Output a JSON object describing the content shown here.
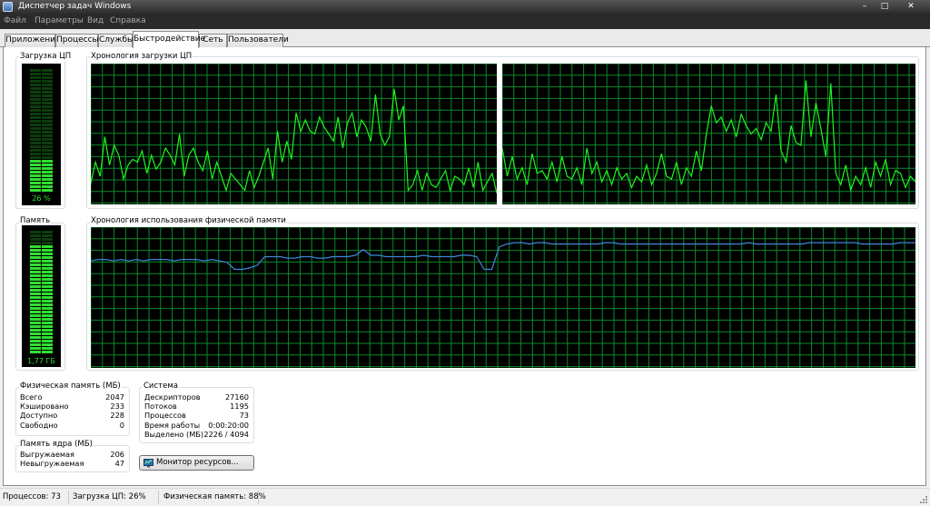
{
  "window": {
    "title": "Диспетчер задач Windows",
    "minimize_glyph": "–",
    "maximize_glyph": "□",
    "close_glyph": "✕"
  },
  "menu": [
    "Файл",
    "Параметры",
    "Вид",
    "Справка"
  ],
  "tabs": [
    "Приложения",
    "Процессы",
    "Службы",
    "Быстродействие",
    "Сеть",
    "Пользователи"
  ],
  "active_tab": "Быстродействие",
  "colors": {
    "grid": "#0a8a2a",
    "cpu_line": "#1df51d",
    "mem_line": "#3f86d8",
    "meter_on": "#2ee12e"
  },
  "cpu_usage": {
    "label": "Загрузка ЦП",
    "value_text": "26 %",
    "percent": 26
  },
  "cpu_history": {
    "label": "Хронология загрузки ЦП",
    "core1": [
      15,
      30,
      20,
      48,
      28,
      42,
      35,
      18,
      28,
      32,
      30,
      38,
      22,
      35,
      25,
      30,
      40,
      35,
      28,
      50,
      20,
      35,
      40,
      30,
      24,
      38,
      18,
      30,
      20,
      10,
      22,
      18,
      14,
      10,
      24,
      12,
      20,
      30,
      40,
      18,
      52,
      30,
      45,
      32,
      65,
      52,
      60,
      52,
      50,
      62,
      55,
      50,
      45,
      62,
      40,
      58,
      65,
      48,
      60,
      55,
      45,
      78,
      50,
      42,
      48,
      82,
      60,
      70,
      10,
      14,
      24,
      10,
      22,
      14,
      12,
      18,
      24,
      10,
      20,
      18,
      14,
      26,
      12,
      30,
      10,
      16,
      22,
      8
    ],
    "core2": [
      40,
      20,
      34,
      18,
      26,
      14,
      36,
      22,
      24,
      18,
      30,
      16,
      34,
      20,
      18,
      26,
      14,
      40,
      22,
      30,
      16,
      24,
      14,
      26,
      18,
      22,
      12,
      20,
      16,
      28,
      14,
      22,
      36,
      20,
      18,
      30,
      14,
      26,
      20,
      38,
      24,
      50,
      70,
      58,
      62,
      52,
      60,
      48,
      64,
      56,
      50,
      54,
      46,
      58,
      52,
      78,
      38,
      30,
      56,
      44,
      42,
      88,
      48,
      72,
      54,
      34,
      86,
      22,
      14,
      28,
      10,
      20,
      14,
      26,
      12,
      30,
      20,
      32,
      14,
      24,
      22,
      12,
      20,
      16
    ]
  },
  "memory": {
    "label": "Память",
    "value_text": "1,77 ГБ",
    "percent": 88
  },
  "memory_history": {
    "label": "Хронология использования физической памяти",
    "values": [
      76,
      77,
      77,
      76,
      77,
      76,
      77,
      76,
      77,
      77,
      77,
      76,
      77,
      77,
      77,
      76,
      77,
      76,
      75,
      70,
      70,
      71,
      73,
      79,
      79,
      79,
      78,
      78,
      79,
      79,
      78,
      78,
      79,
      79,
      79,
      80,
      84,
      80,
      80,
      79,
      79,
      79,
      79,
      79,
      80,
      79,
      79,
      79,
      79,
      80,
      80,
      79,
      70,
      70,
      86,
      88,
      89,
      89,
      88,
      89,
      89,
      88,
      88,
      88,
      88,
      88,
      88,
      88,
      89,
      89,
      88,
      88,
      88,
      88,
      88,
      88,
      88,
      88,
      88,
      88,
      88,
      88,
      88,
      88,
      88,
      88,
      88,
      89,
      88,
      88,
      88,
      88,
      88,
      88,
      88,
      89,
      89,
      89,
      89,
      89,
      89,
      89,
      88,
      88,
      88,
      88,
      88,
      89,
      89,
      89
    ]
  },
  "physical_memory": {
    "label": "Физическая память (МБ)",
    "rows": [
      {
        "name": "Всего",
        "value": "2047"
      },
      {
        "name": "Кэшировано",
        "value": "233"
      },
      {
        "name": "Доступно",
        "value": "228"
      },
      {
        "name": "Свободно",
        "value": "0"
      }
    ]
  },
  "kernel_memory": {
    "label": "Память ядра (МБ)",
    "rows": [
      {
        "name": "Выгружаемая",
        "value": "206"
      },
      {
        "name": "Невыгружаемая",
        "value": "47"
      }
    ]
  },
  "system": {
    "label": "Система",
    "rows": [
      {
        "name": "Дескрипторов",
        "value": "27160"
      },
      {
        "name": "Потоков",
        "value": "1195"
      },
      {
        "name": "Процессов",
        "value": "73"
      },
      {
        "name": "Время работы",
        "value": "0:00:20:00"
      },
      {
        "name": "Выделено (МБ)",
        "value": "2226 / 4094"
      }
    ]
  },
  "resource_monitor_button": "Монитор ресурсов...",
  "statusbar": {
    "processes": "Процессов: 73",
    "cpu": "Загрузка ЦП: 26%",
    "memory": "Физическая память: 88%"
  }
}
